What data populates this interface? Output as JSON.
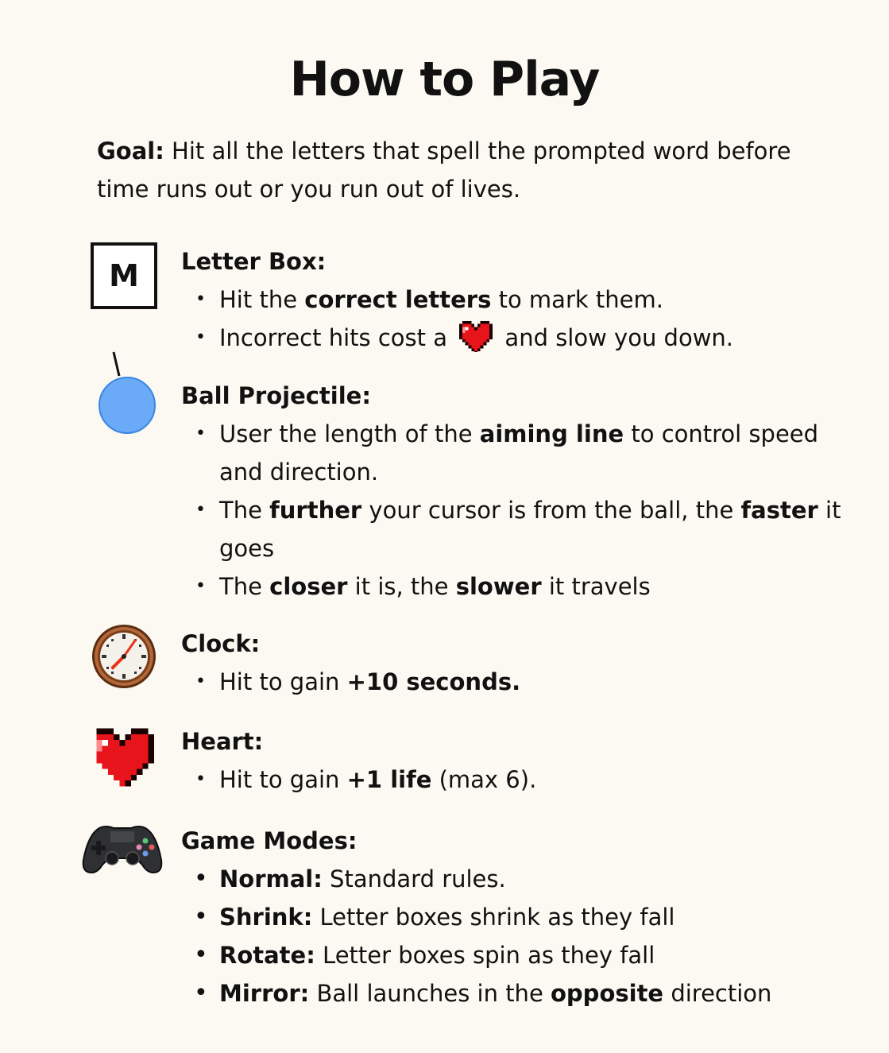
{
  "title": "How to Play",
  "goal": {
    "label": "Goal:",
    "text": " Hit all the letters that spell the prompted word before time runs out or you run out of lives."
  },
  "letter_box": {
    "icon_letter": "M",
    "heading": "Letter Box:",
    "b1": {
      "pre": "Hit the ",
      "bold": "correct letters",
      "post": " to mark them."
    },
    "b2": {
      "pre": "Incorrect hits cost a ",
      "post": " and slow you down."
    }
  },
  "ball": {
    "heading": "Ball Projectile:",
    "b1": {
      "pre": "User the length of the ",
      "bold": "aiming line",
      "post": " to control speed and direction."
    },
    "b2": {
      "pre": "The ",
      "bold1": "further",
      "mid": " your cursor is from the ball, the ",
      "bold2": "faster",
      "post": " it goes"
    },
    "b3": {
      "pre": "The ",
      "bold1": "closer",
      "mid": " it is, the ",
      "bold2": "slower",
      "post": " it travels"
    }
  },
  "clock": {
    "heading": "Clock:",
    "b1": {
      "pre": "Hit to gain ",
      "bold": "+10 seconds."
    }
  },
  "heart": {
    "heading": "Heart:",
    "b1": {
      "pre": "Hit to gain ",
      "bold": "+1 life",
      "post": " (max 6)."
    }
  },
  "modes": {
    "heading": "Game Modes:",
    "items": [
      {
        "name": "Normal:",
        "desc": " Standard rules."
      },
      {
        "name": "Shrink:",
        "desc": " Letter boxes shrink as they fall"
      },
      {
        "name": "Rotate:",
        "desc": " Letter boxes spin as they fall"
      },
      {
        "name": "Mirror:",
        "desc_pre": " Ball launches in the ",
        "desc_bold": "opposite",
        "desc_post": " direction"
      }
    ]
  },
  "colors": {
    "background": "#fbf9f1",
    "ball": "#6aaaf7",
    "heart": "#e8141b"
  }
}
